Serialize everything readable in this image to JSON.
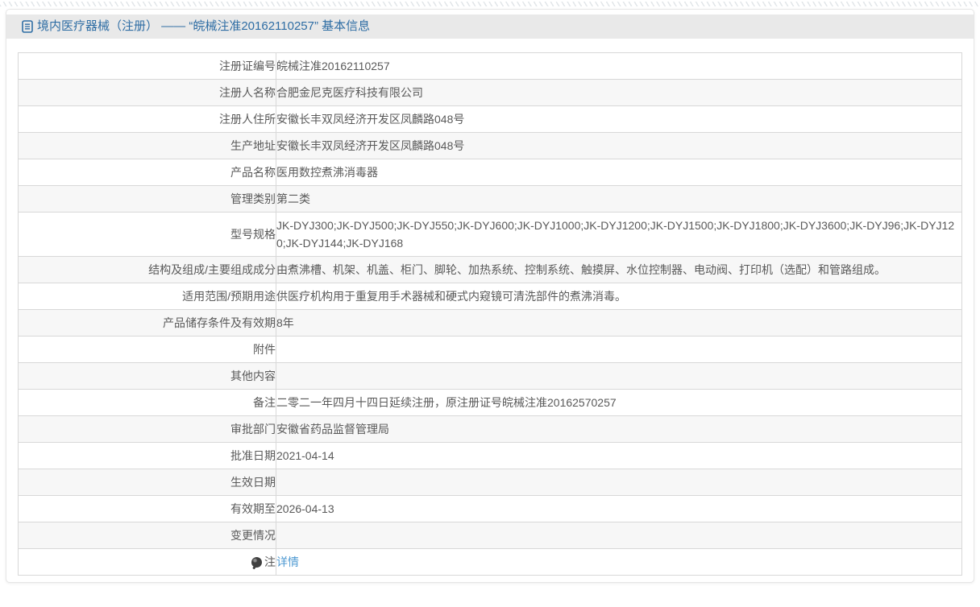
{
  "header": {
    "title": "境内医疗器械（注册） —— “皖械注准20162110257” 基本信息",
    "icon": "document-icon"
  },
  "colors": {
    "accent_blue": "#2e6da4",
    "link_blue": "#4f9ad2",
    "header_bg": "#e9e9e9",
    "row_alt_bg": "#f7f7f7",
    "border": "#d8d8d8",
    "text": "#595959"
  },
  "table": {
    "rows": [
      {
        "label": "注册证编号",
        "value": "皖械注准20162110257"
      },
      {
        "label": "注册人名称",
        "value": "合肥金尼克医疗科技有限公司"
      },
      {
        "label": "注册人住所",
        "value": "安徽长丰双凤经济开发区凤麟路048号"
      },
      {
        "label": "生产地址",
        "value": "安徽长丰双凤经济开发区凤麟路048号"
      },
      {
        "label": "产品名称",
        "value": "医用数控煮沸消毒器"
      },
      {
        "label": "管理类别",
        "value": "第二类"
      },
      {
        "label": "型号规格",
        "value": "JK-DYJ300;JK-DYJ500;JK-DYJ550;JK-DYJ600;JK-DYJ1000;JK-DYJ1200;JK-DYJ1500;JK-DYJ1800;JK-DYJ3600;JK-DYJ96;JK-DYJ120;JK-DYJ144;JK-DYJ168"
      },
      {
        "label": "结构及组成/主要组成成分",
        "value": "由煮沸槽、机架、机盖、柜门、脚轮、加热系统、控制系统、触摸屏、水位控制器、电动阀、打印机（选配）和管路组成。"
      },
      {
        "label": "适用范围/预期用途",
        "value": "供医疗机构用于重复用手术器械和硬式内窥镜可清洗部件的煮沸消毒。"
      },
      {
        "label": "产品储存条件及有效期",
        "value": "8年"
      },
      {
        "label": "附件",
        "value": ""
      },
      {
        "label": "其他内容",
        "value": ""
      },
      {
        "label": "备注",
        "value": "二零二一年四月十四日延续注册，原注册证号皖械注准20162570257"
      },
      {
        "label": "审批部门",
        "value": "安徽省药品监督管理局"
      },
      {
        "label": "批准日期",
        "value": "2021-04-14"
      },
      {
        "label": "生效日期",
        "value": ""
      },
      {
        "label": "有效期至",
        "value": "2026-04-13"
      },
      {
        "label": "变更情况",
        "value": ""
      },
      {
        "label": "注",
        "value": "详情",
        "note_icon": "bulb-note-icon"
      }
    ]
  }
}
